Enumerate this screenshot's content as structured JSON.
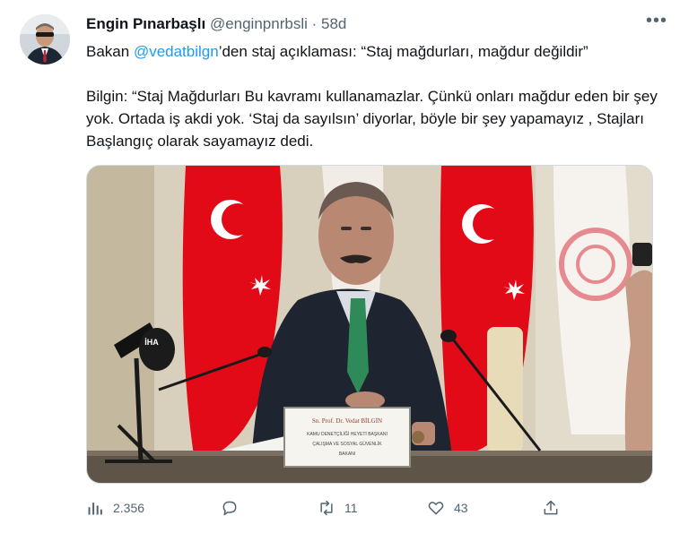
{
  "tweet": {
    "author_name": "Engin Pınarbaşlı",
    "author_handle": "@enginpnrbsli",
    "separator": "·",
    "time": "58d",
    "more_label": "•••",
    "text_prefix": "Bakan ",
    "mention": "@vedatbilgn",
    "text_suffix": "’den staj açıklaması: “Staj mağdurları, mağdur değildir”",
    "body": "Bilgin: “Staj Mağdurları Bu kavramı kullanamazlar. Çünkü onları mağdur eden bir şey yok. Ortada iş akdi yok. ‘Staj da sayılsın’ diyorlar, böyle bir şey yapamayız , Stajları Başlangıç olarak sayamayız dedi."
  },
  "media": {
    "nameplate_name": "Sn. Prof. Dr. Vedat BİLGİN",
    "nameplate_line1": "KAMU DENETÇİLİĞİ HEYETİ BAŞKANI",
    "nameplate_line2": "ÇALIŞMA VE SOSYAL GÜVENLİK",
    "nameplate_line3": "BAKANI",
    "mic_label": "İHA"
  },
  "actions": {
    "views": "2.356",
    "retweets": "11",
    "likes": "43"
  },
  "colors": {
    "accent": "#1d9bf0",
    "muted": "#536471",
    "flag_red": "#e30a17"
  }
}
